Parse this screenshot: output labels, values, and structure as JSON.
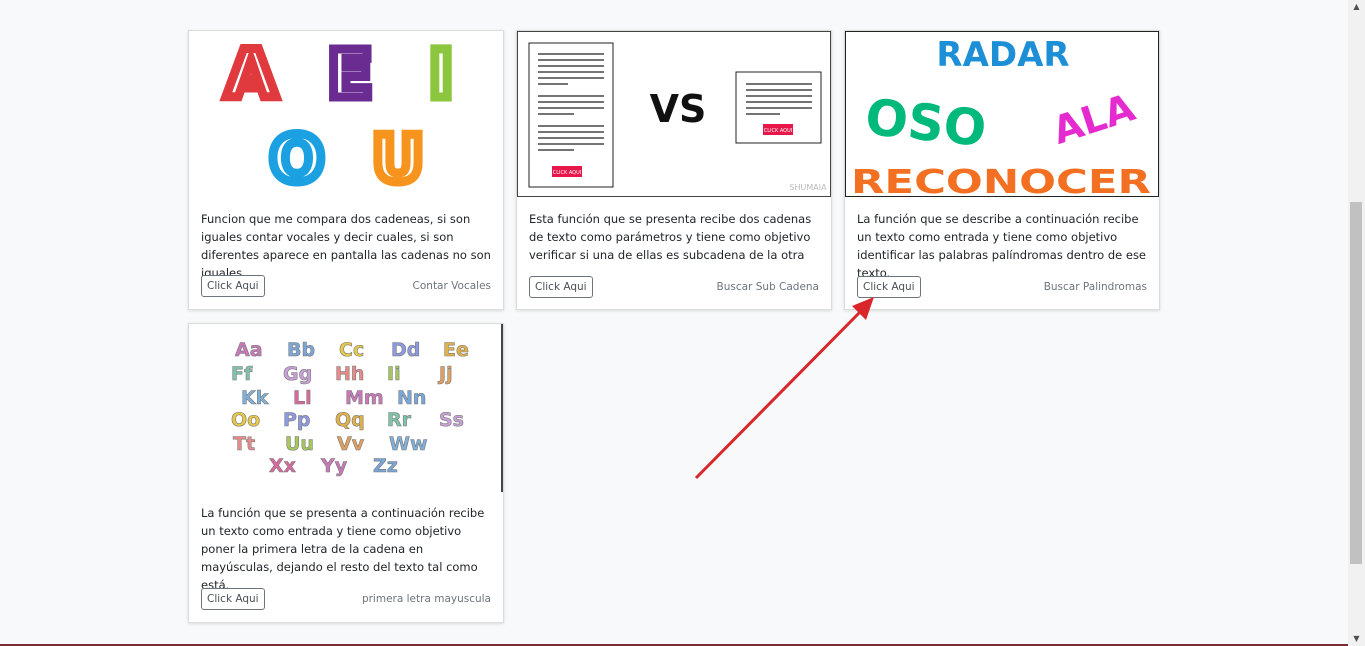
{
  "cards": [
    {
      "description": "Funcion que me compara dos cadeneas, si son iguales contar vocales y decir cuales, si son diferentes aparece en pantalla las cadenas no son iguales",
      "button_label": "Click Aqui",
      "footer_label": "Contar Vocales",
      "image": {
        "letters": [
          "A",
          "E",
          "I",
          "O",
          "U"
        ]
      }
    },
    {
      "description": "Esta función que se presenta recibe dos cadenas de texto como parámetros y tiene como objetivo verificar si una de ellas es subcadena de la otra",
      "button_label": "Click Aqui",
      "footer_label": "Buscar Sub Cadena",
      "image": {
        "vs": "VS",
        "doc_button": "¡CLICK AQUI!",
        "watermark": "SHUMAIA"
      }
    },
    {
      "description": "La función que se describe a continuación recibe un texto como entrada y tiene como objetivo identificar las palabras palíndromas dentro de ese texto.",
      "button_label": "Click Aqui",
      "footer_label": "Buscar Palindromas",
      "image": {
        "words": [
          "RADAR",
          "OSO",
          "ALA",
          "RECONOCER"
        ]
      }
    },
    {
      "description": "La función que se presenta a continuación recibe un texto como entrada y tiene como objetivo poner la primera letra de la cadena en mayúsculas, dejando el resto del texto tal como está.",
      "button_label": "Click Aqui",
      "footer_label": "primera letra mayuscula",
      "image": {
        "alphabet_rows": [
          [
            "Aa",
            "Bb",
            "Cc",
            "Dd",
            "Ee"
          ],
          [
            "Ff",
            "Gg",
            "Hh",
            "Ii",
            "Jj"
          ],
          [
            "Kk",
            "Ll",
            "Mm",
            "Nn"
          ],
          [
            "Oo",
            "Pp",
            "Qq",
            "Rr",
            "Ss"
          ],
          [
            "Tt",
            "Uu",
            "Vv",
            "Ww"
          ],
          [
            "Xx",
            "Yy",
            "Zz"
          ]
        ]
      }
    }
  ],
  "colors": {
    "vowel_A": "#e03a3e",
    "vowel_E": "#6a2c91",
    "vowel_I": "#8cc63f",
    "vowel_O": "#1ba1e2",
    "vowel_U": "#f7941d",
    "radar": "#1c8fd6",
    "oso": "#00b97a",
    "ala": "#e52bd0",
    "reconocer": "#f36f21",
    "annotation_arrow": "#d9262a"
  }
}
